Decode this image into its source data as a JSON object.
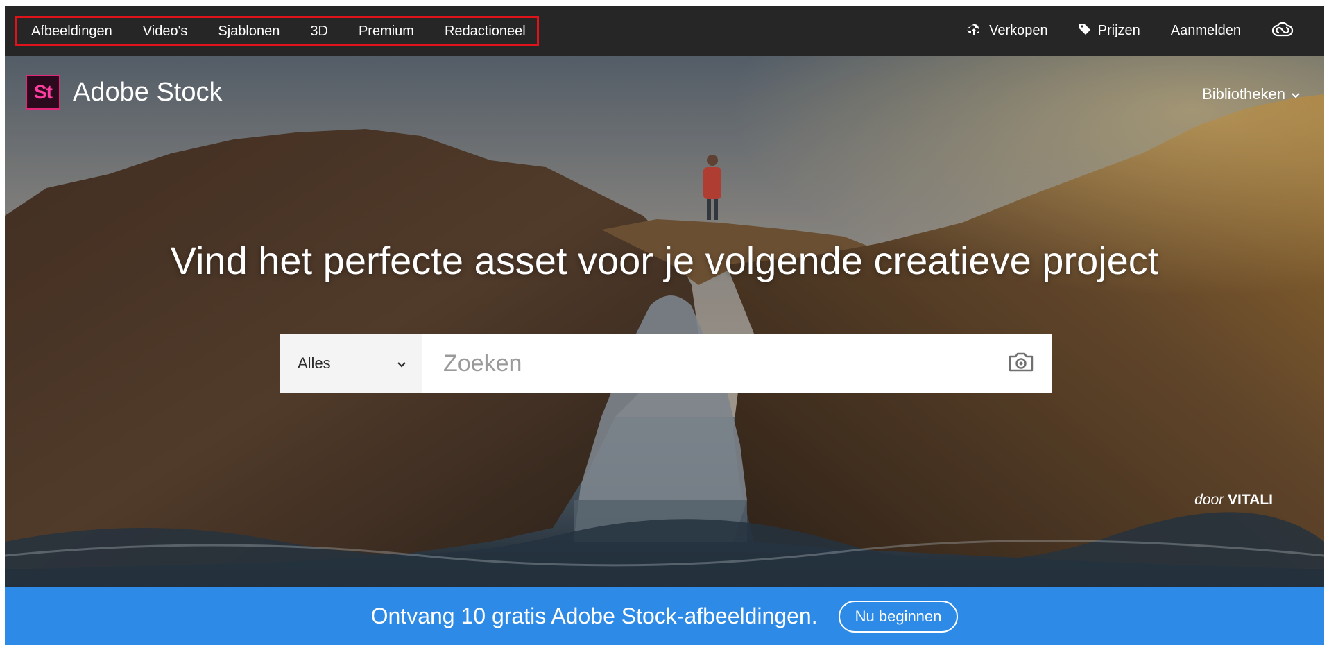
{
  "topnav": {
    "left_items": [
      {
        "label": "Afbeeldingen"
      },
      {
        "label": "Video's"
      },
      {
        "label": "Sjablonen"
      },
      {
        "label": "3D"
      },
      {
        "label": "Premium"
      },
      {
        "label": "Redactioneel"
      }
    ],
    "right_items": {
      "sell": {
        "label": "Verkopen",
        "icon": "cloud-upload-icon"
      },
      "pricing": {
        "label": "Prijzen",
        "icon": "price-tag-icon"
      },
      "signin": {
        "label": "Aanmelden"
      },
      "cc_icon": "creative-cloud-icon"
    }
  },
  "brand": {
    "logo_text": "St",
    "name": "Adobe Stock"
  },
  "libraries": {
    "label": "Bibliotheken",
    "icon": "chevron-down-icon"
  },
  "hero": {
    "headline": "Vind het perfecte asset voor je volgende creatieve project",
    "credit_by": "door",
    "credit_name": "VITALI"
  },
  "search": {
    "category_selected": "Alles",
    "placeholder": "Zoeken",
    "camera_icon": "camera-icon"
  },
  "promo": {
    "text": "Ontvang 10 gratis Adobe Stock-afbeeldingen.",
    "button_label": "Nu beginnen"
  },
  "colors": {
    "topnav_bg": "#262626",
    "highlight_border": "#e0131a",
    "promo_bg": "#2d8ae6",
    "logo_pink": "#ff3ea0"
  }
}
